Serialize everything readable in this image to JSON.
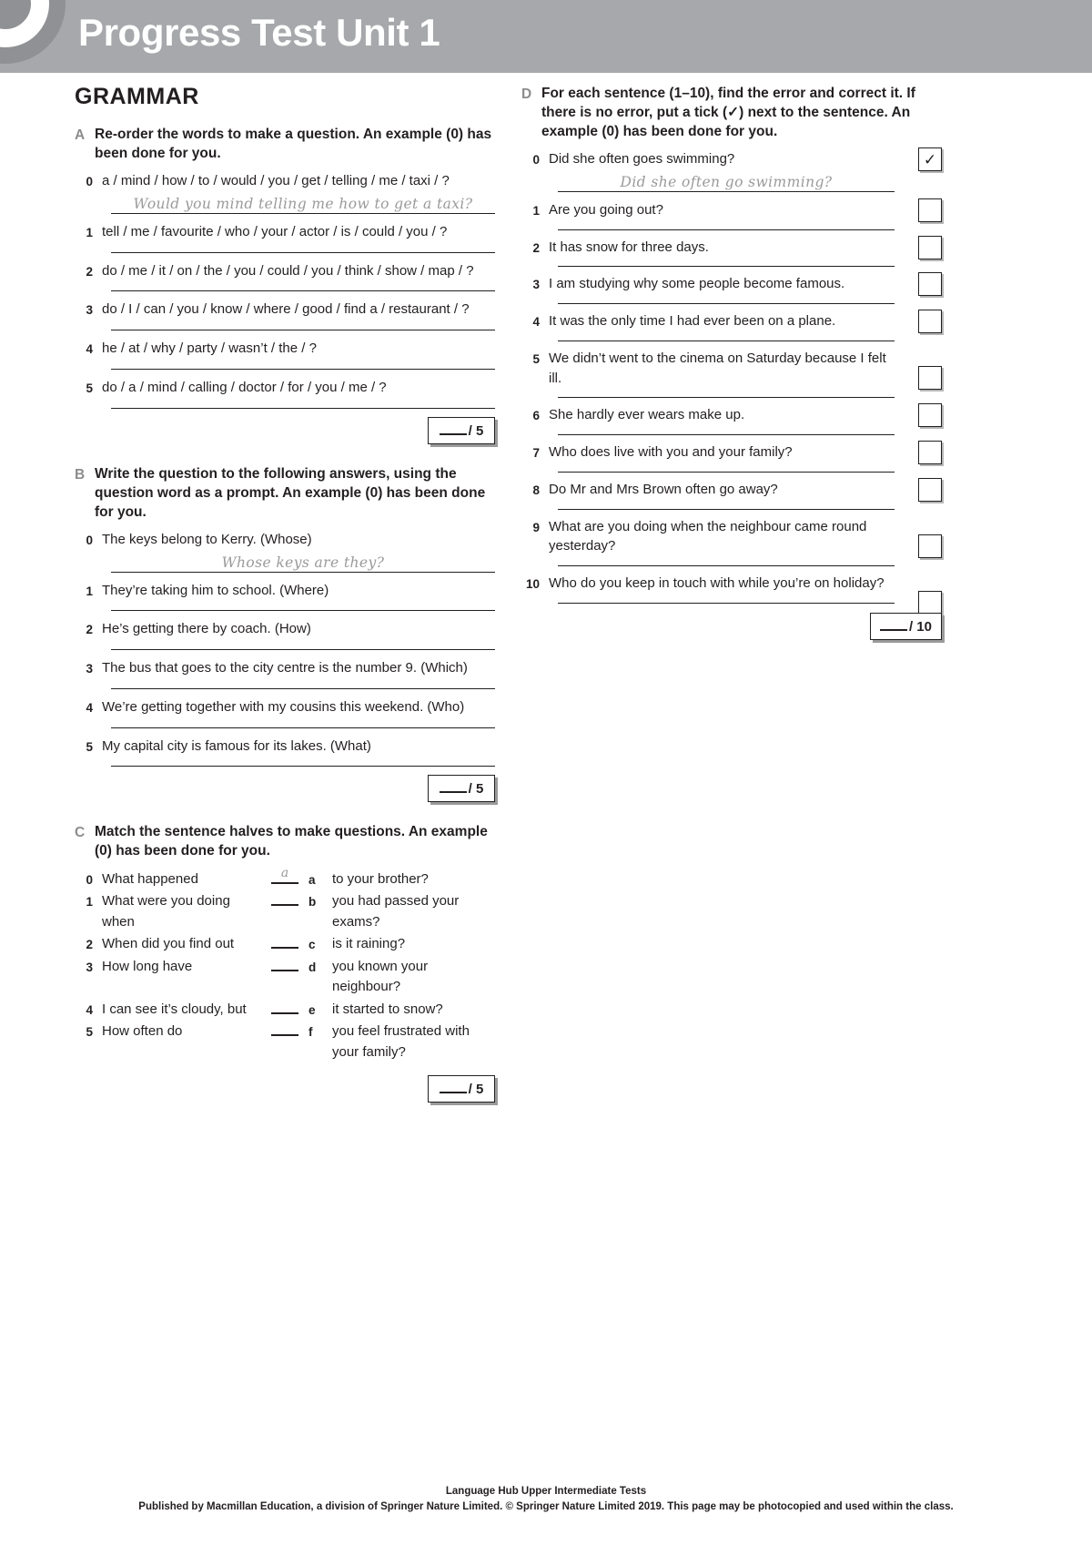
{
  "header": {
    "title": "Progress Test Unit 1",
    "band_color": "#a6a8ab"
  },
  "section_title": "GRAMMAR",
  "exercises": {
    "A": {
      "letter": "A",
      "instruction": "Re-order the words to make a question. An example (0) has been done for you.",
      "items": [
        {
          "num": "0",
          "text": "a / mind / how / to / would / you / get / telling / me / taxi / ?",
          "answer": "Would you mind telling me how to get a taxi?"
        },
        {
          "num": "1",
          "text": "tell / me / favourite / who / your / actor / is / could / you / ?",
          "answer": ""
        },
        {
          "num": "2",
          "text": "do / me / it / on / the / you / could / you / think / show / map / ?",
          "answer": ""
        },
        {
          "num": "3",
          "text": "do / I / can / you / know / where / good / find a / restaurant / ?",
          "answer": ""
        },
        {
          "num": "4",
          "text": "he / at / why / party / wasn’t / the / ?",
          "answer": ""
        },
        {
          "num": "5",
          "text": "do / a / mind / calling / doctor / for / you / me / ?",
          "answer": ""
        }
      ],
      "score_max": "/ 5"
    },
    "B": {
      "letter": "B",
      "instruction": "Write the question to the following answers, using the question word as a prompt. An example (0) has been done for you.",
      "items": [
        {
          "num": "0",
          "text": "The keys belong to Kerry. (Whose)",
          "answer": "Whose keys are they?"
        },
        {
          "num": "1",
          "text": "They’re taking him to school. (Where)",
          "answer": ""
        },
        {
          "num": "2",
          "text": "He’s getting there by coach. (How)",
          "answer": ""
        },
        {
          "num": "3",
          "text": "The bus that goes to the city centre is the number 9. (Which)",
          "answer": ""
        },
        {
          "num": "4",
          "text": "We’re getting together with my cousins this weekend. (Who)",
          "answer": ""
        },
        {
          "num": "5",
          "text": "My capital city is famous for its lakes. (What)",
          "answer": ""
        }
      ],
      "score_max": "/ 5"
    },
    "C": {
      "letter": "C",
      "instruction": "Match the sentence halves to make questions. An example (0) has been done for you.",
      "rows": [
        {
          "num": "0",
          "left": "What happened",
          "answer": "a",
          "letter": "a",
          "right": "to your brother?"
        },
        {
          "num": "1",
          "left": "What were you doing when",
          "answer": "",
          "letter": "b",
          "right": "you had passed your exams?"
        },
        {
          "num": "2",
          "left": "When did you find out",
          "answer": "",
          "letter": "c",
          "right": "is it raining?"
        },
        {
          "num": "3",
          "left": "How long have",
          "answer": "",
          "letter": "d",
          "right": "you known your neighbour?"
        },
        {
          "num": "4",
          "left": "I can see it’s cloudy, but",
          "answer": "",
          "letter": "e",
          "right": "it started to snow?"
        },
        {
          "num": "5",
          "left": "How often do",
          "answer": "",
          "letter": "f",
          "right": "you feel frustrated with your family?"
        }
      ],
      "score_max": "/ 5"
    },
    "D": {
      "letter": "D",
      "instruction": "For each sentence (1–10), find the error and correct it. If there is no error, put a tick (✓) next to the sentence. An example (0) has been done for you.",
      "items": [
        {
          "num": "0",
          "text": "Did she often goes swimming?",
          "answer": "Did she often go swimming?",
          "tick": "✓"
        },
        {
          "num": "1",
          "text": "Are you going out?",
          "answer": "",
          "tick": ""
        },
        {
          "num": "2",
          "text": "It has snow for three days.",
          "answer": "",
          "tick": ""
        },
        {
          "num": "3",
          "text": "I am studying why some people become famous.",
          "answer": "",
          "tick": ""
        },
        {
          "num": "4",
          "text": "It was the only time I had ever been on a plane.",
          "answer": "",
          "tick": ""
        },
        {
          "num": "5",
          "text": "We didn’t went to the cinema on Saturday because I felt ill.",
          "answer": "",
          "tick": ""
        },
        {
          "num": "6",
          "text": "She hardly ever wears make up.",
          "answer": "",
          "tick": ""
        },
        {
          "num": "7",
          "text": "Who does live with you and your family?",
          "answer": "",
          "tick": ""
        },
        {
          "num": "8",
          "text": "Do Mr and Mrs Brown often go away?",
          "answer": "",
          "tick": ""
        },
        {
          "num": "9",
          "text": "What are you doing when the neighbour came round yesterday?",
          "answer": "",
          "tick": ""
        },
        {
          "num": "10",
          "text": "Who do you keep in touch with while you’re on holiday?",
          "answer": "",
          "tick": ""
        }
      ],
      "score_max": "/ 10"
    }
  },
  "footer": {
    "line1": "Language Hub Upper Intermediate Tests",
    "line2": "Published by Macmillan Education, a division of Springer Nature Limited. © Springer Nature Limited 2019. This page may be photocopied and used within the class."
  }
}
